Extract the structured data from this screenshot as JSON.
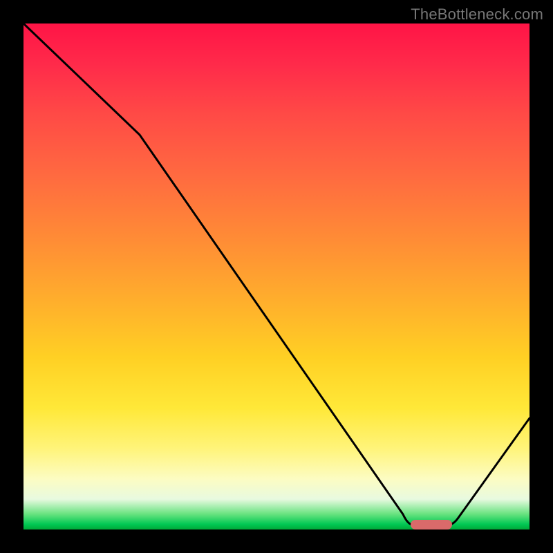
{
  "watermark": "TheBottleneck.com",
  "chart_data": {
    "type": "line",
    "title": "",
    "xlabel": "",
    "ylabel": "",
    "x_range": [
      0,
      100
    ],
    "y_range": [
      0,
      100
    ],
    "series": [
      {
        "name": "curve",
        "x": [
          0,
          23,
          75,
          77,
          84,
          100
        ],
        "y": [
          100,
          78,
          3,
          1,
          1,
          22
        ]
      }
    ],
    "marker": {
      "x_start": 77,
      "x_end": 84,
      "y": 1
    },
    "gradient_stops": [
      {
        "pos": 0,
        "color": "#ff1446"
      },
      {
        "pos": 30,
        "color": "#ff6a40"
      },
      {
        "pos": 66,
        "color": "#ffd024"
      },
      {
        "pos": 90,
        "color": "#fcfcc2"
      },
      {
        "pos": 100,
        "color": "#00a838"
      }
    ]
  }
}
